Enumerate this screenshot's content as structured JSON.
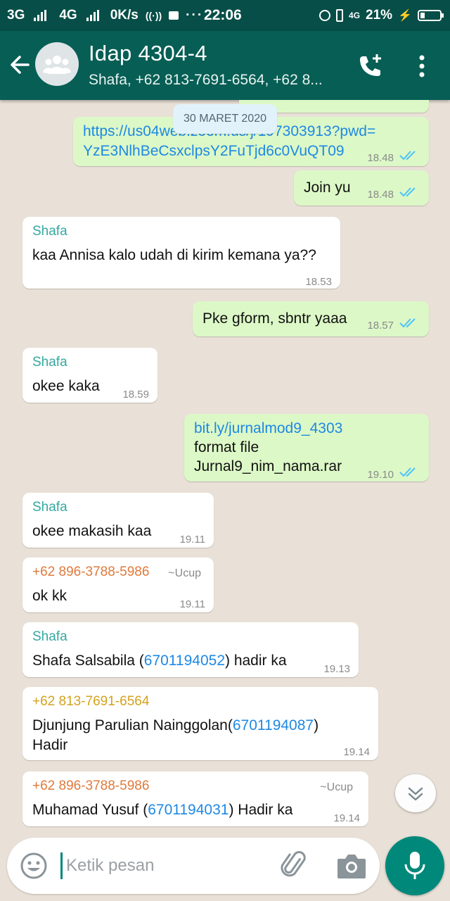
{
  "status_bar": {
    "network_1": "3G",
    "network_2": "4G",
    "speed": "0K/s",
    "time": "22:06",
    "lte": "4G",
    "battery": "21%"
  },
  "header": {
    "title": "Idap 4304-4",
    "subtitle": "Shafa, +62 813-7691-6564, +62 8..."
  },
  "date_chip": "30 MARET 2020",
  "messages": [
    {
      "dir": "out",
      "link": "https://us04web.zoom.us/j/197303913?pwd=",
      "link2": "YzE3NlhBeCsxclpsY2FuTjd6c0VuQT09",
      "time": "18.48"
    },
    {
      "dir": "out",
      "text": "Join yu",
      "time": "18.48"
    },
    {
      "dir": "in",
      "sender": "Shafa",
      "text": "kaa Annisa kalo udah di kirim kemana ya??",
      "time": "18.53"
    },
    {
      "dir": "out",
      "text": "Pke gform, sbntr yaaa",
      "time": "18.57"
    },
    {
      "dir": "in",
      "sender": "Shafa",
      "text": "okee kaka",
      "time": "18.59"
    },
    {
      "dir": "out",
      "link": "bit.ly/jurnalmod9_4303",
      "line2": "format file",
      "line3": "Jurnal9_nim_nama.rar",
      "time": "19.10"
    },
    {
      "dir": "in",
      "sender": "Shafa",
      "text": "okee makasih kaa",
      "time": "19.11"
    },
    {
      "dir": "in",
      "sender": "+62 896-3788-5986",
      "pushname": "~Ucup",
      "text": "ok kk",
      "time": "19.11"
    },
    {
      "dir": "in",
      "sender": "Shafa",
      "text_a": "Shafa Salsabila (",
      "num": "6701194052",
      "text_b": ") hadir ka",
      "time": "19.13"
    },
    {
      "dir": "in",
      "sender": "+62 813-7691-6564",
      "text_a": "Djunjung Parulian Nainggolan(",
      "num": "6701194087",
      "text_b": ")",
      "line2": "Hadir",
      "time": "19.14"
    },
    {
      "dir": "in",
      "sender": "+62 896-3788-5986",
      "pushname": "~Ucup",
      "text_a": "Muhamad Yusuf (",
      "num": "6701194031",
      "text_b": ") Hadir ka",
      "time": "19.14"
    }
  ],
  "composer": {
    "placeholder": "Ketik pesan"
  },
  "colors": {
    "header": "#075e54",
    "status_bar": "#064e47",
    "outgoing_bubble": "#dcf8c6",
    "incoming_bubble": "#ffffff",
    "sender_shafa": "#35a8a0",
    "sender_5986": "#e07a3c",
    "sender_6564": "#d4a21c",
    "link": "#1e88e5",
    "read_ticks": "#4fc3f7",
    "accent": "#00897b"
  },
  "icons": [
    "back-arrow-icon",
    "group-avatar-icon",
    "add-call-icon",
    "more-vert-icon",
    "double-check-icon",
    "scroll-down-icon",
    "emoji-icon",
    "attach-icon",
    "camera-icon",
    "mic-icon"
  ]
}
